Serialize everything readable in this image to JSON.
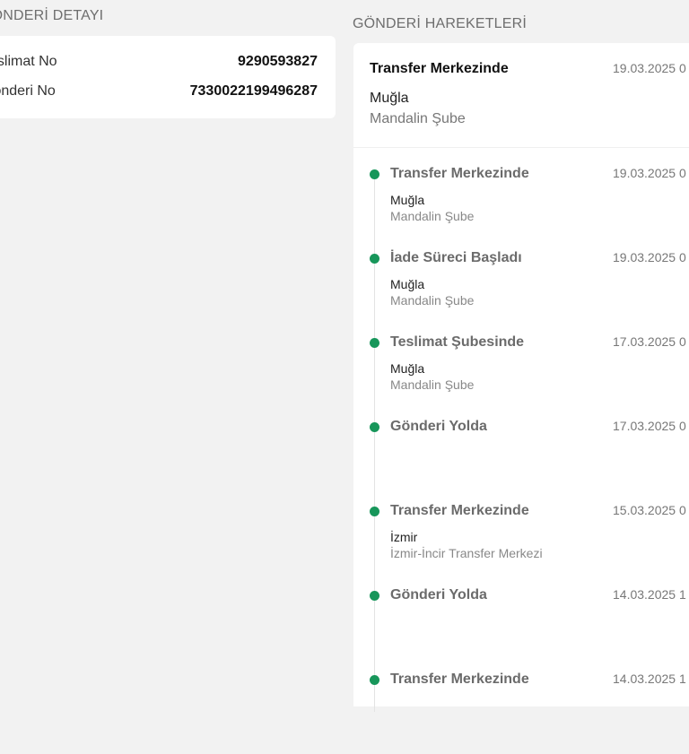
{
  "detail": {
    "title": "GÖNDERİ DETAYI",
    "rows": [
      {
        "label": "Teslimat No",
        "value": "9290593827"
      },
      {
        "label": "Gönderi No",
        "value": "7330022199496287"
      }
    ]
  },
  "movements": {
    "title": "GÖNDERİ HAREKETLERİ",
    "latest": {
      "status": "Transfer Merkezinde",
      "date": "19.03.2025 0",
      "city": "Muğla",
      "branch": "Mandalin Şube"
    },
    "items": [
      {
        "status": "Transfer Merkezinde",
        "date": "19.03.2025 0",
        "city": "Muğla",
        "branch": "Mandalin Şube"
      },
      {
        "status": "İade Süreci Başladı",
        "date": "19.03.2025 0",
        "city": "Muğla",
        "branch": "Mandalin Şube"
      },
      {
        "status": "Teslimat Şubesinde",
        "date": "17.03.2025 0",
        "city": "Muğla",
        "branch": "Mandalin Şube"
      },
      {
        "status": "Gönderi Yolda",
        "date": "17.03.2025 0",
        "city": "",
        "branch": ""
      },
      {
        "status": "Transfer Merkezinde",
        "date": "15.03.2025 0",
        "city": "İzmir",
        "branch": "İzmir-İncir Transfer Merkezi"
      },
      {
        "status": "Gönderi Yolda",
        "date": "14.03.2025 1",
        "city": "",
        "branch": ""
      },
      {
        "status": "Transfer Merkezinde",
        "date": "14.03.2025 1",
        "city": "",
        "branch": ""
      }
    ],
    "accent_color": "#17965a"
  }
}
